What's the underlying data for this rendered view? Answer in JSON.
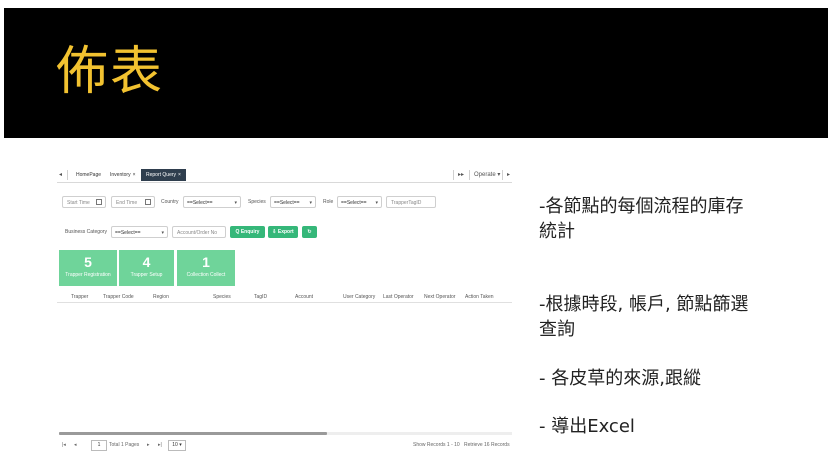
{
  "slide": {
    "title": "佈表",
    "colors": {
      "header_bg": "#000000",
      "title": "#f2c230",
      "accent_button": "#35b779",
      "card": "#6fd49a",
      "active_tab": "#2f3e4e"
    }
  },
  "app": {
    "tabs": {
      "first_arrow": "◂",
      "items": [
        "HomePage",
        "Inventory",
        "Report Query"
      ],
      "active": "Report Query",
      "close": "×",
      "right_arrow": "▸▸",
      "operate": "Operate ▾",
      "end_arrow": "▸"
    },
    "filters": {
      "start_time": "Start Time",
      "end_time": "End Time",
      "country_label": "Country",
      "country_value": "==Select==",
      "species_label": "Species",
      "species_value": "==Select==",
      "role_label": "Role",
      "role_value": "==Select==",
      "tag_placeholder": "TrapperTagID",
      "business_category_label": "Business Category",
      "business_category_value": "==Select==",
      "account_placeholder": "Account/Order No",
      "enquiry_button": "Q Enquiry",
      "export_button": "⇩ Export",
      "refresh_icon": "refresh-icon"
    },
    "cards": [
      {
        "value": "5",
        "label": "Trapper Registration"
      },
      {
        "value": "4",
        "label": "Trapper Setup"
      },
      {
        "value": "1",
        "label": "Collection Collect"
      }
    ],
    "table_headers": [
      "Trapper",
      "Trapper Code",
      "Region",
      "Species",
      "TagID",
      "Account",
      "User Category",
      "Last Operator",
      "Next Operator",
      "Action Taken"
    ],
    "pager": {
      "first": "|◂",
      "prev": "◂",
      "page": "1",
      "total": "Total 1 Pages",
      "next": "▸",
      "last": "▸|",
      "page_size": "10 ▾",
      "show_records": "Show Records 1 - 10",
      "retrieve": "Retrieve 16 Records"
    }
  },
  "bullets": [
    "-各節點的每個流程的庫存",
    "統計",
    "-根據時段, 帳戶, 節點篩選",
    "查詢",
    "- 各皮草的來源,跟縱",
    "- 導出Excel"
  ]
}
